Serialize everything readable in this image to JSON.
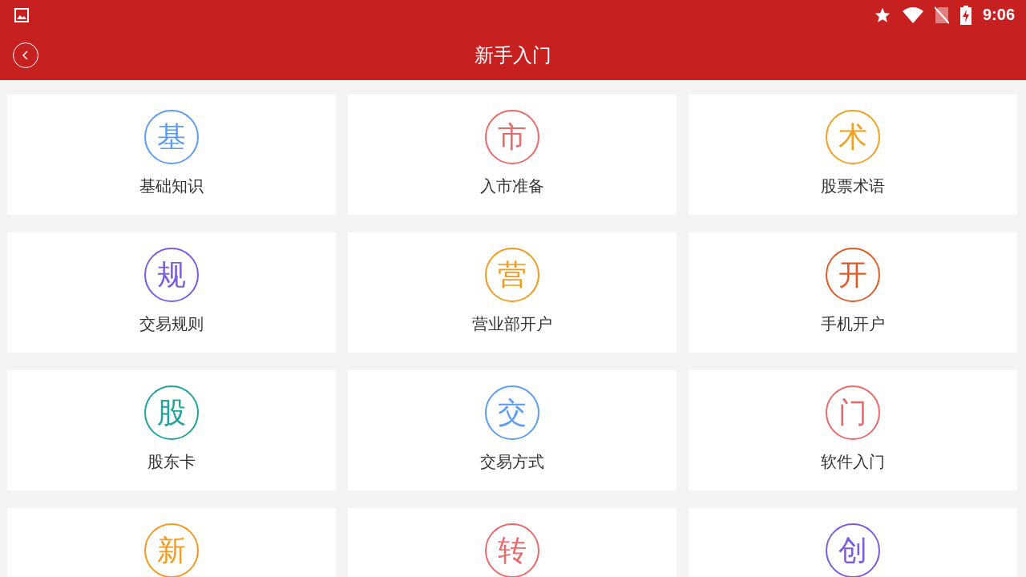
{
  "status_bar": {
    "time": "9:06"
  },
  "toolbar": {
    "title": "新手入门"
  },
  "items": [
    {
      "badge": "基",
      "label": "基础知识",
      "color": "#5b9df0"
    },
    {
      "badge": "市",
      "label": "入市准备",
      "color": "#e96a6a"
    },
    {
      "badge": "术",
      "label": "股票术语",
      "color": "#f0a020"
    },
    {
      "badge": "规",
      "label": "交易规则",
      "color": "#7b5ce0"
    },
    {
      "badge": "营",
      "label": "营业部开户",
      "color": "#f29a1e"
    },
    {
      "badge": "开",
      "label": "手机开户",
      "color": "#e05a25"
    },
    {
      "badge": "股",
      "label": "股东卡",
      "color": "#1fa39a"
    },
    {
      "badge": "交",
      "label": "交易方式",
      "color": "#5b9df0"
    },
    {
      "badge": "门",
      "label": "软件入门",
      "color": "#e96a6a"
    },
    {
      "badge": "新",
      "color": "#f29a1e"
    },
    {
      "badge": "转",
      "color": "#e96a6a"
    },
    {
      "badge": "创",
      "color": "#7b5ce0"
    }
  ]
}
